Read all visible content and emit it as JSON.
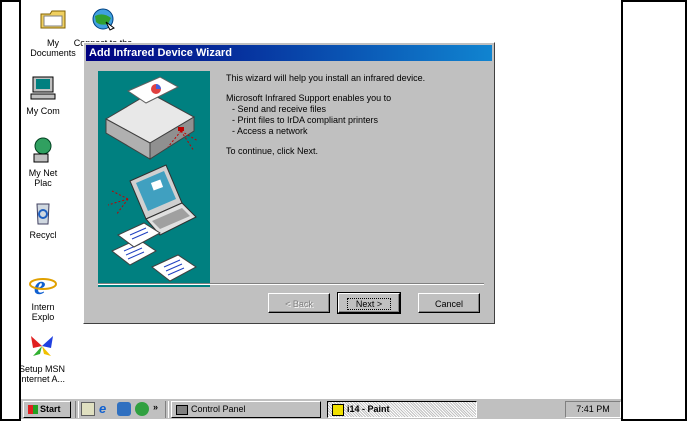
{
  "desktop": {
    "icons": [
      {
        "label": "My Documents",
        "label2": ""
      },
      {
        "label": "Connect to the",
        "label2": ""
      },
      {
        "label": "My Com",
        "label2": ""
      },
      {
        "label": "My Net",
        "label2": "Plac"
      },
      {
        "label": "Recycl",
        "label2": ""
      },
      {
        "label": "Intern",
        "label2": "Explo"
      },
      {
        "label": "Setup MSN",
        "label2": "Internet A..."
      }
    ]
  },
  "wizard": {
    "title": "Add Infrared Device Wizard",
    "intro": "This wizard will help you install an infrared device.",
    "support_heading": "Microsoft Infrared Support enables you to",
    "items": [
      "- Send and receive files",
      "- Print files to IrDA compliant printers",
      "- Access a network"
    ],
    "continue_text": "To continue, click Next.",
    "back_label": "< Back",
    "next_label": "Next >",
    "cancel_label": "Cancel"
  },
  "taskbar": {
    "start_label": "Start",
    "chevron": "»",
    "tasks": [
      {
        "label": "Control Panel"
      },
      {
        "label": "i14 - Paint"
      }
    ],
    "clock": "7:41 PM"
  },
  "colors": {
    "title_start": "#000080",
    "title_end": "#1084d0",
    "wizard_art": "#008080",
    "face": "#c0c0c0"
  }
}
